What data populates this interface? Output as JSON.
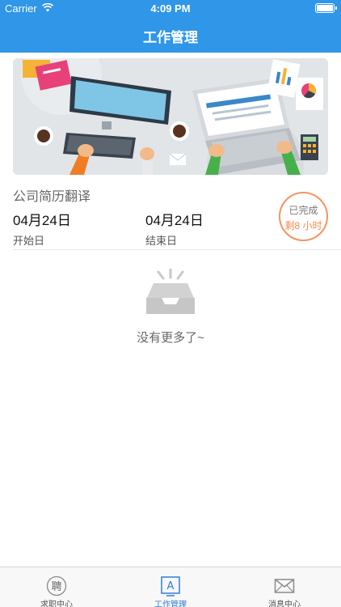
{
  "status_bar": {
    "carrier": "Carrier",
    "time": "4:09 PM"
  },
  "header": {
    "title": "工作管理",
    "background": "#2f96e8"
  },
  "task": {
    "title": "公司简历翻译",
    "start_date": "04月24日",
    "start_label": "开始日",
    "end_date": "04月24日",
    "end_label": "结束日",
    "status": "已完成",
    "remaining": "剩8 小时",
    "stamp_color": "#f19560"
  },
  "empty_state": {
    "text": "没有更多了~",
    "icon": "empty-inbox-icon"
  },
  "tabbar": {
    "items": [
      {
        "label": "求职中心",
        "icon": "pin-hire-icon",
        "glyph": "聘"
      },
      {
        "label": "工作管理",
        "icon": "a-badge-icon",
        "glyph": "A",
        "active": true
      },
      {
        "label": "消息中心",
        "icon": "envelope-icon"
      }
    ],
    "active_color": "#2f7fd8"
  }
}
